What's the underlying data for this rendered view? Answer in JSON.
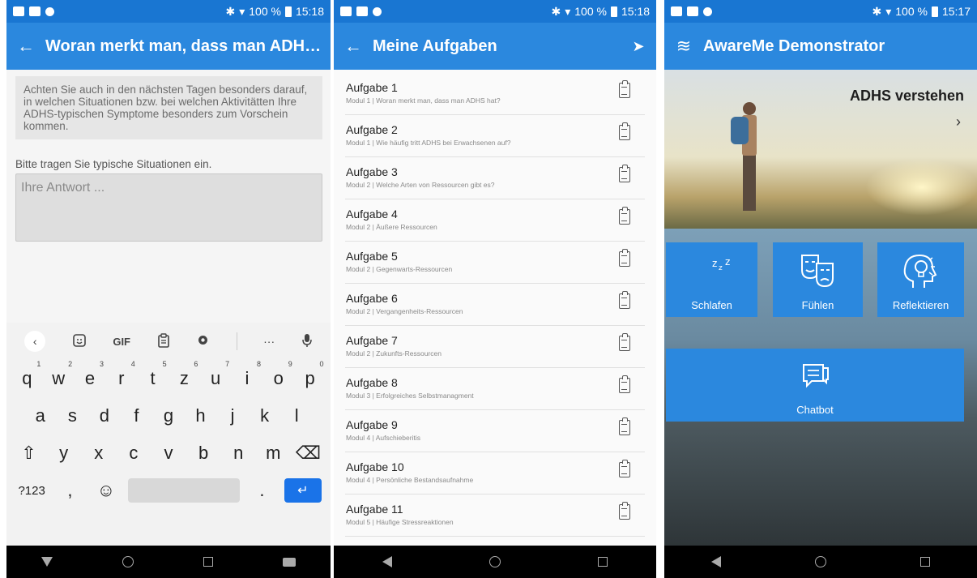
{
  "status_bar": {
    "left": {
      "battery": "100 %",
      "time": "15:18"
    },
    "middle": {
      "battery": "100 %",
      "time": "15:18"
    },
    "right": {
      "battery": "100 %",
      "time": "15:17"
    }
  },
  "screen_question": {
    "title": "Woran merkt man, dass man ADH…",
    "info_text": "Achten Sie auch in den nächsten Tagen besonders darauf, in welchen Situationen bzw. bei welchen Aktivitätten Ihre ADHS-typischen Symptome besonders zum Vorschein kommen.",
    "prompt": "Bitte tragen Sie typische Situationen ein.",
    "answer_placeholder": "Ihre Antwort ...",
    "keyboard": {
      "gif_label": "GIF",
      "more_label": "···",
      "row1": [
        {
          "k": "q",
          "n": "1"
        },
        {
          "k": "w",
          "n": "2"
        },
        {
          "k": "e",
          "n": "3"
        },
        {
          "k": "r",
          "n": "4"
        },
        {
          "k": "t",
          "n": "5"
        },
        {
          "k": "z",
          "n": "6"
        },
        {
          "k": "u",
          "n": "7"
        },
        {
          "k": "i",
          "n": "8"
        },
        {
          "k": "o",
          "n": "9"
        },
        {
          "k": "p",
          "n": "0"
        }
      ],
      "row2": [
        "a",
        "s",
        "d",
        "f",
        "g",
        "h",
        "j",
        "k",
        "l"
      ],
      "row3": [
        "y",
        "x",
        "c",
        "v",
        "b",
        "n",
        "m"
      ],
      "shift_glyph": "⇧",
      "delete_glyph": "⌫",
      "symbols_label": "?123",
      "comma": ",",
      "emoji_glyph": "☺",
      "period": ".",
      "enter_glyph": "↵"
    }
  },
  "screen_tasks": {
    "title": "Meine Aufgaben",
    "tasks": [
      {
        "title": "Aufgabe 1",
        "subtitle": "Modul 1 | Woran merkt man, dass man ADHS hat?"
      },
      {
        "title": "Aufgabe 2",
        "subtitle": "Modul 1 | Wie häufig tritt ADHS bei Erwachsenen auf?"
      },
      {
        "title": "Aufgabe 3",
        "subtitle": "Modul 2 | Welche Arten von Ressourcen gibt es?"
      },
      {
        "title": "Aufgabe 4",
        "subtitle": "Modul 2 | Äußere Ressourcen"
      },
      {
        "title": "Aufgabe 5",
        "subtitle": "Modul 2 | Gegenwarts-Ressourcen"
      },
      {
        "title": "Aufgabe 6",
        "subtitle": "Modul 2 | Vergangenheits-Ressourcen"
      },
      {
        "title": "Aufgabe 7",
        "subtitle": "Modul 2 | Zukunfts-Ressourcen"
      },
      {
        "title": "Aufgabe 8",
        "subtitle": "Modul 3 | Erfolgreiches Selbstmanagment"
      },
      {
        "title": "Aufgabe 9",
        "subtitle": "Modul 4 | Aufschieberitis"
      },
      {
        "title": "Aufgabe 10",
        "subtitle": "Modul 4 | Persönliche Bestandsaufnahme"
      },
      {
        "title": "Aufgabe 11",
        "subtitle": "Modul 5 | Häufige Stressreaktionen"
      }
    ]
  },
  "screen_home": {
    "title": "AwareMe Demonstrator",
    "hero_title": "ADHS verstehen",
    "tiles": {
      "sleep": "Schlafen",
      "feel": "Fühlen",
      "reflect": "Reflektieren",
      "chatbot": "Chatbot"
    }
  },
  "colors": {
    "status_bar": "#1976d2",
    "app_bar": "#2b88de",
    "tile": "#2b88de",
    "enter_key": "#1a73e8"
  }
}
